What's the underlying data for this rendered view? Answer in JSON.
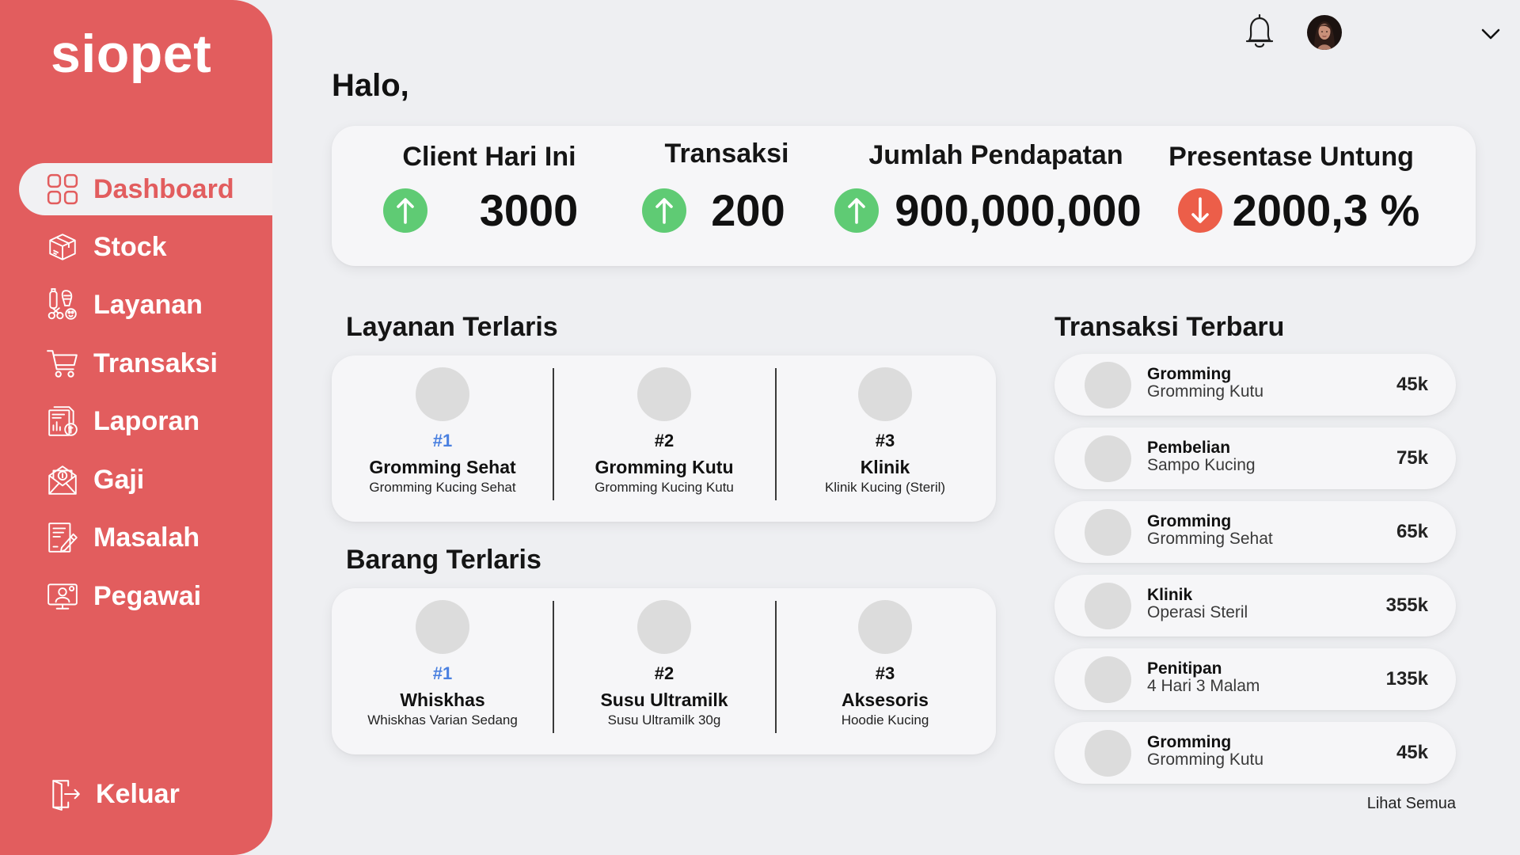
{
  "colors": {
    "sidebar": "#E25D5E",
    "background": "#EEEFF2",
    "active_pill": "#F1F1F3",
    "card": "#F6F6F8",
    "trend_up": "#5FCB74",
    "trend_down": "#EC5E49",
    "rank_first": "#4A80E0"
  },
  "app": {
    "logo": "siopet"
  },
  "sidebar": {
    "items": [
      {
        "label": "Dashboard",
        "icon": "dashboard-grid-icon",
        "active": true
      },
      {
        "label": "Stock",
        "icon": "box-icon"
      },
      {
        "label": "Layanan",
        "icon": "grooming-tools-icon"
      },
      {
        "label": "Transaksi",
        "icon": "cart-icon"
      },
      {
        "label": "Laporan",
        "icon": "report-icon"
      },
      {
        "label": "Gaji",
        "icon": "salary-envelope-icon"
      },
      {
        "label": "Masalah",
        "icon": "issue-document-icon"
      },
      {
        "label": "Pegawai",
        "icon": "employee-icon"
      }
    ],
    "logout": {
      "label": "Keluar",
      "icon": "logout-door-icon"
    }
  },
  "header": {
    "notification_icon": "bell-icon",
    "avatar_icon": "user-avatar",
    "menu_icon": "chevron-down-icon"
  },
  "greeting": "Halo,",
  "stats": [
    {
      "title": "Client Hari Ini",
      "value": "3000",
      "trend_icon": "arrow-up-icon"
    },
    {
      "title": "Transaksi",
      "value": "200",
      "trend_icon": "arrow-up-icon"
    },
    {
      "title": "Jumlah Pendapatan",
      "value": "900,000,000",
      "trend_icon": "arrow-up-icon"
    },
    {
      "title": "Presentase Untung",
      "value": "2000,3 %",
      "trend_icon": "arrow-down-icon"
    }
  ],
  "top_services": {
    "title": "Layanan Terlaris",
    "items": [
      {
        "rank": "#1",
        "name": "Gromming Sehat",
        "description": "Gromming Kucing Sehat"
      },
      {
        "rank": "#2",
        "name": "Gromming Kutu",
        "description": "Gromming Kucing Kutu"
      },
      {
        "rank": "#3",
        "name": "Klinik",
        "description": "Klinik Kucing (Steril)"
      }
    ]
  },
  "top_products": {
    "title": "Barang Terlaris",
    "items": [
      {
        "rank": "#1",
        "name": "Whiskhas",
        "description": "Whiskhas Varian Sedang"
      },
      {
        "rank": "#2",
        "name": "Susu Ultramilk",
        "description": "Susu Ultramilk 30g"
      },
      {
        "rank": "#3",
        "name": "Aksesoris",
        "description": "Hoodie Kucing"
      }
    ]
  },
  "recent_transactions": {
    "title": "Transaksi Terbaru",
    "items": [
      {
        "category": "Gromming",
        "name": "Gromming Kutu",
        "amount": "45k"
      },
      {
        "category": "Pembelian",
        "name": "Sampo Kucing",
        "amount": "75k"
      },
      {
        "category": "Gromming",
        "name": "Gromming Sehat",
        "amount": "65k"
      },
      {
        "category": "Klinik",
        "name": "Operasi Steril",
        "amount": "355k"
      },
      {
        "category": "Penitipan",
        "name": "4 Hari 3 Malam",
        "amount": "135k"
      },
      {
        "category": "Gromming",
        "name": "Gromming Kutu",
        "amount": "45k"
      }
    ],
    "view_all": "Lihat Semua"
  }
}
